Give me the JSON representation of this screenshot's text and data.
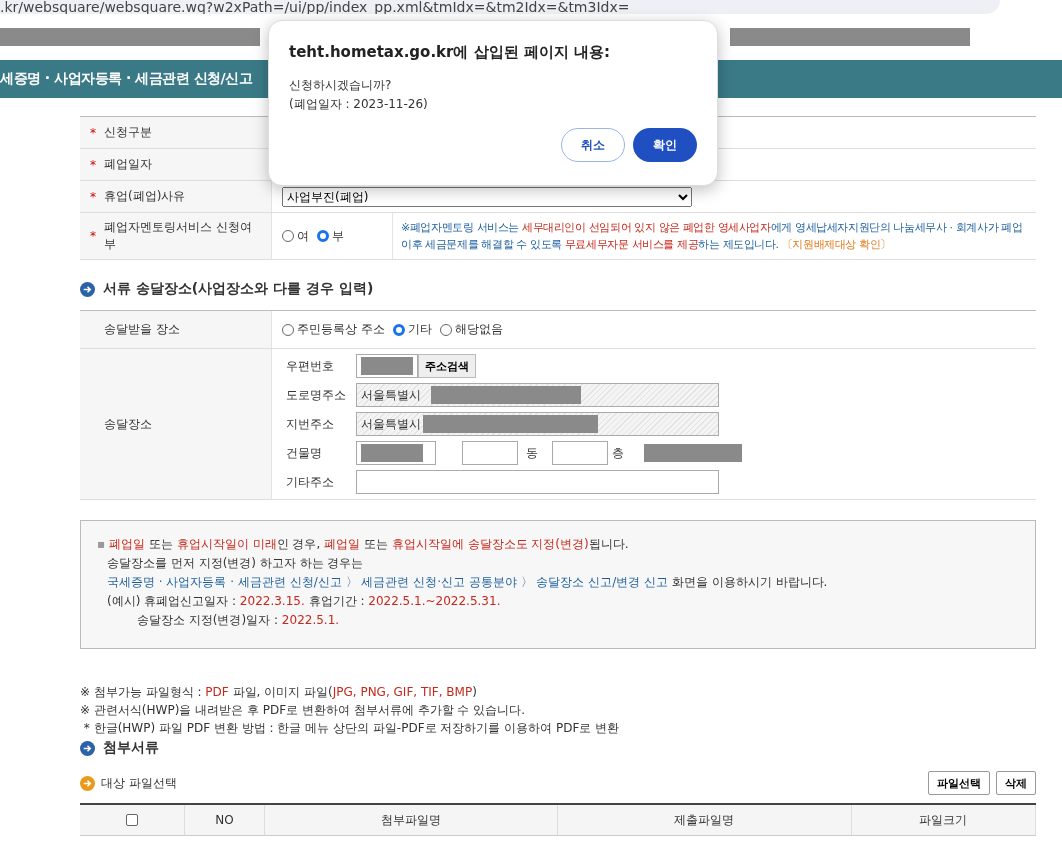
{
  "browser": {
    "url": ".kr/websquare/websquare.wq?w2xPath=/ui/pp/index_pp.xml&tmIdx=&tm2Idx=&tm3Idx="
  },
  "header": {
    "title": "세증명 · 사업자등록 · 세금관련 신청/신고"
  },
  "dialog": {
    "title": "teht.hometax.go.kr에 삽입된 페이지 내용:",
    "message": "신청하시겠습니까?",
    "detail": "(폐업일자 : 2023-11-26)",
    "buttons": [
      {
        "label": "취소",
        "kind": "secondary"
      },
      {
        "label": "확인",
        "kind": "primary"
      }
    ]
  },
  "form": {
    "rows": [
      {
        "mark": "*",
        "label": "신청구분",
        "kind": "blank"
      },
      {
        "mark": "*",
        "label": "폐업일자",
        "kind": "blank"
      },
      {
        "mark": "*",
        "label": "휴업(폐업)사유",
        "kind": "select",
        "value": "사업부진(폐업)"
      },
      {
        "mark": "*",
        "label": "폐업자멘토링서비스 신청여부",
        "kind": "radio",
        "options": [
          {
            "label": "여",
            "selected": false
          },
          {
            "label": "부",
            "selected": true
          }
        ],
        "notice": [
          {
            "text": "※폐업자멘토링 서비스는 ",
            "kind": "blue"
          },
          {
            "text": "세무대리인이 선임되어 있지 않은 폐업한 영세사업자",
            "kind": "red"
          },
          {
            "text": "에게 영세납세자지원단의 나눔세무사 · 회계사가 폐업 이후 세금문제를 해결할 수 있도록 ",
            "kind": "blue"
          },
          {
            "text": "무료세무자문 서비스를 제공",
            "kind": "red"
          },
          {
            "text": "하는 제도입니다. ",
            "kind": "blue"
          },
          {
            "text": "〔지원배제대상 확인〕",
            "kind": "orange"
          }
        ]
      }
    ]
  },
  "delivery": {
    "heading": "서류 송달장소(사업장소와 다를 경우 입력)",
    "place_label": "송달받을 장소",
    "place_options": [
      {
        "label": "주민등록상 주소",
        "selected": false
      },
      {
        "label": "기타",
        "selected": true
      },
      {
        "label": "해당없음",
        "selected": false
      }
    ],
    "address_label": "송달장소",
    "postcode_label": "우편번호",
    "search_button": "주소검색",
    "road_label": "도로명주소",
    "road_value": "서울특별시",
    "lot_label": "지번주소",
    "lot_value": "서울특별시",
    "building_label": "건물명",
    "dong_label": "동",
    "floor_label": "층",
    "etc_label": "기타주소"
  },
  "info": {
    "bullet": "▪",
    "lines": [
      [
        {
          "text": "폐업일",
          "kind": "red"
        },
        {
          "text": " 또는 ",
          "kind": "plain"
        },
        {
          "text": "휴업시작일이 미래",
          "kind": "red"
        },
        {
          "text": "인 경우, ",
          "kind": "plain"
        },
        {
          "text": "폐업일",
          "kind": "red"
        },
        {
          "text": " 또는 ",
          "kind": "plain"
        },
        {
          "text": "휴업시작일에 송달장소도 지정(변경)",
          "kind": "red"
        },
        {
          "text": "됩니다.",
          "kind": "plain"
        }
      ],
      [
        {
          "text": "송달장소를 먼저 지정(변경) 하고자 하는 경우는",
          "kind": "plain"
        }
      ],
      [
        {
          "text": "국세증명 · 사업자등록 · 세금관련 신청/신고 〉 세금관련 신청·신고 공통분야 〉 송달장소 신고/변경 신고",
          "kind": "blue"
        },
        {
          "text": " 화면을 이용하시기 바랍니다.",
          "kind": "plain"
        }
      ],
      [
        {
          "text": "(예시) 휴폐업신고일자 : ",
          "kind": "plain"
        },
        {
          "text": "2022.3.15.",
          "kind": "red"
        },
        {
          "text": "     휴업기간 : ",
          "kind": "plain"
        },
        {
          "text": "2022.5.1.~2022.5.31.",
          "kind": "red"
        }
      ],
      [
        {
          "text": "송달장소 지정(변경)일자 : ",
          "kind": "plain"
        },
        {
          "text": "2022.5.1.",
          "kind": "red"
        }
      ]
    ]
  },
  "notes": [
    [
      {
        "text": "※ 첨부가능 파일형식 : ",
        "kind": "plain"
      },
      {
        "text": "PDF",
        "kind": "red"
      },
      {
        "text": " 파일, 이미지 파일(",
        "kind": "plain"
      },
      {
        "text": "JPG, PNG, GIF, TIF, BMP",
        "kind": "red"
      },
      {
        "text": ")",
        "kind": "plain"
      }
    ],
    [
      {
        "text": "※ 관련서식(HWP)을 내려받은 후 PDF로 변환하여 첨부서류에 추가할 수 있습니다.",
        "kind": "plain"
      }
    ],
    [
      {
        "text": " * 한글(HWP) 파일 PDF 변환 방법 : 한글 메뉴 상단의 파일-PDF로 저장하기를 이용하여 PDF로 변환",
        "kind": "plain"
      }
    ]
  ],
  "attachments": {
    "heading": "첨부서류",
    "subheading": "대상 파일선택",
    "buttons": [
      "파일선택",
      "삭제"
    ],
    "columns": [
      "NO",
      "첨부파일명",
      "제출파일명",
      "파일크기"
    ],
    "all_checked": false
  }
}
